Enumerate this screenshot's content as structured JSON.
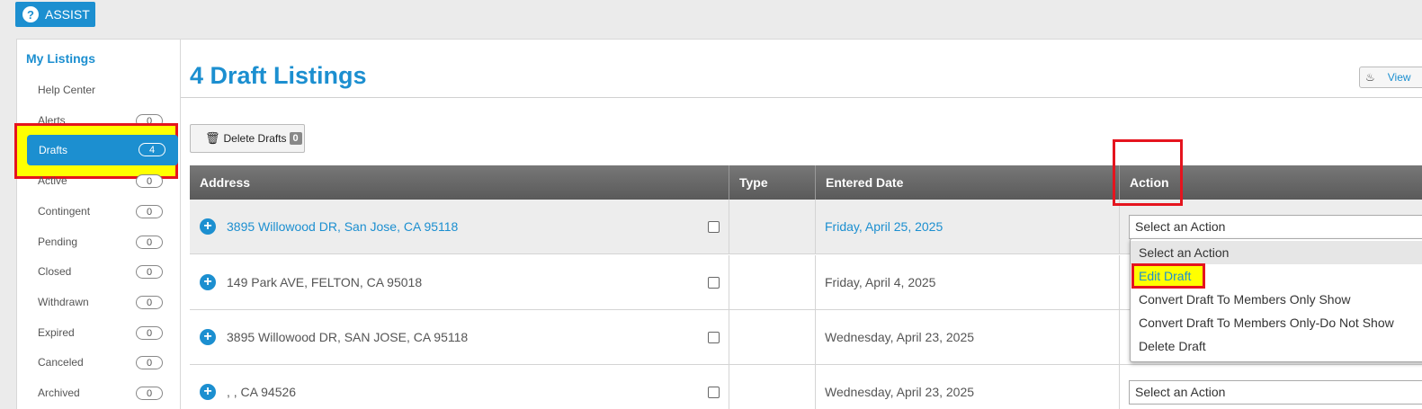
{
  "assist": {
    "label": "ASSIST"
  },
  "sidebar": {
    "title": "My Listings",
    "items": [
      {
        "label": "Help Center",
        "count": null
      },
      {
        "label": "Alerts",
        "count": "0"
      },
      {
        "label": "Drafts",
        "count": "4"
      },
      {
        "label": "Active",
        "count": "0"
      },
      {
        "label": "Contingent",
        "count": "0"
      },
      {
        "label": "Pending",
        "count": "0"
      },
      {
        "label": "Closed",
        "count": "0"
      },
      {
        "label": "Withdrawn",
        "count": "0"
      },
      {
        "label": "Expired",
        "count": "0"
      },
      {
        "label": "Canceled",
        "count": "0"
      },
      {
        "label": "Archived",
        "count": "0"
      }
    ]
  },
  "main": {
    "title": "4 Draft Listings",
    "view_label": "View",
    "delete_label": "Delete Drafts",
    "delete_count": "0"
  },
  "table": {
    "headers": [
      "Address",
      "Type",
      "Entered Date",
      "Action"
    ],
    "rows": [
      {
        "address": "3895 Willowood DR, San Jose, CA 95118",
        "type": "",
        "date": "Friday, April 25, 2025",
        "action": "Select an Action"
      },
      {
        "address": "149 Park AVE, FELTON, CA 95018",
        "type": "",
        "date": "Friday, April 4, 2025",
        "action": ""
      },
      {
        "address": "3895 Willowood DR, SAN JOSE, CA 95118",
        "type": "",
        "date": "Wednesday, April 23, 2025",
        "action": ""
      },
      {
        "address": ", , CA 94526",
        "type": "",
        "date": "Wednesday, April 23, 2025",
        "action": "Select an Action"
      }
    ]
  },
  "dropdown": {
    "options": [
      "Select an Action",
      "Edit Draft",
      "Convert Draft To Members Only Show",
      "Convert Draft To Members Only-Do Not Show",
      "Delete Draft"
    ]
  },
  "colors": {
    "accent": "#1c8fd0",
    "highlight_border": "#e5141e",
    "highlight_fill": "#ffff00"
  }
}
